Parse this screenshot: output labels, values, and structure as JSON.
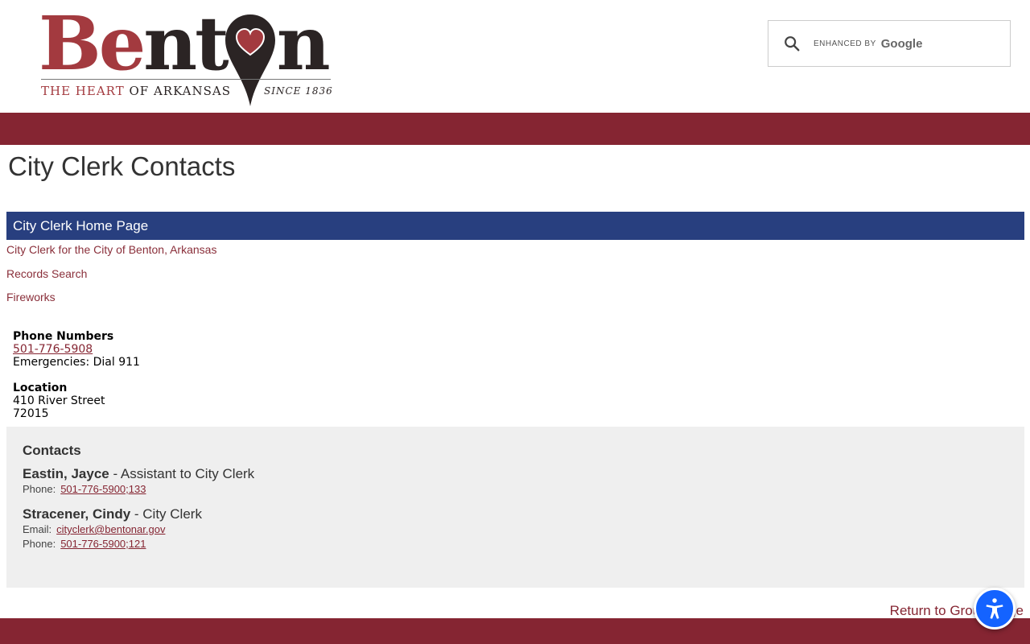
{
  "header": {
    "logo": {
      "word_red": "Be",
      "word_dark_a": "nt",
      "word_dark_b": "n",
      "tagline_red": "THE HEART",
      "tagline_dark": " OF ARKANSAS",
      "since": "SINCE 1836"
    },
    "search": {
      "enhanced_by": "ENHANCED BY",
      "google": "Google"
    }
  },
  "page": {
    "title": "City Clerk Contacts"
  },
  "nav": {
    "home_label": "City Clerk Home Page",
    "links": [
      "City Clerk for the City of Benton, Arkansas",
      "Records Search",
      "Fireworks"
    ]
  },
  "info": {
    "phone_heading": "Phone Numbers",
    "phone": "501-776-5908",
    "emergency": "Emergencies: Dial 911",
    "location_heading": "Location",
    "street": "410 River Street",
    "zip": "72015"
  },
  "contacts": {
    "heading": "Contacts",
    "people": [
      {
        "name": "Eastin, Jayce",
        "role": " - Assistant to City Clerk",
        "phone_label": "Phone:",
        "phone": "501-776-5900;133"
      },
      {
        "name": "Stracener, Cindy",
        "role": " - City Clerk",
        "email_label": "Email:",
        "email": "cityclerk@bentonar.gov",
        "phone_label": "Phone:",
        "phone": "501-776-5900;121"
      }
    ]
  },
  "footer": {
    "return_link": "Return to Group Page"
  },
  "colors": {
    "brand_red": "#852532",
    "nav_blue": "#283f7f",
    "accessibility_blue": "#1463ff"
  },
  "icons": {
    "search": "search-icon",
    "accessibility": "accessibility-icon",
    "logo_pin": "heart-pin-icon"
  }
}
